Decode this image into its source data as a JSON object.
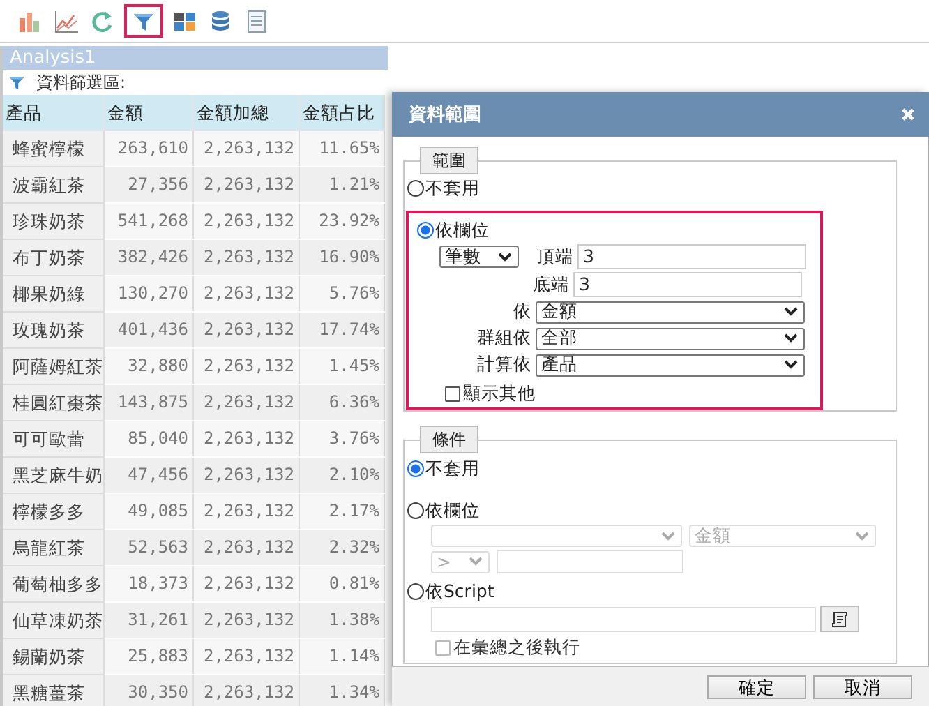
{
  "toolbar": {
    "buttons": [
      {
        "kind": "bar-chart",
        "highlighted": false
      },
      {
        "kind": "line-chart",
        "highlighted": false
      },
      {
        "kind": "refresh",
        "highlighted": false
      },
      {
        "kind": "filter",
        "highlighted": true
      },
      {
        "kind": "crosstab",
        "highlighted": false
      },
      {
        "kind": "database",
        "highlighted": false
      },
      {
        "kind": "report",
        "highlighted": false
      }
    ]
  },
  "panel": {
    "title": "Analysis1",
    "filter_label": "資料篩選區:",
    "table": {
      "columns": [
        "產品",
        "金額",
        "金額加總",
        "金額占比"
      ],
      "rows": [
        [
          "蜂蜜檸檬",
          "263,610",
          "2,263,132",
          "11.65%"
        ],
        [
          "波霸紅茶",
          "27,356",
          "2,263,132",
          "1.21%"
        ],
        [
          "珍珠奶茶",
          "541,268",
          "2,263,132",
          "23.92%"
        ],
        [
          "布丁奶茶",
          "382,426",
          "2,263,132",
          "16.90%"
        ],
        [
          "椰果奶綠",
          "130,270",
          "2,263,132",
          "5.76%"
        ],
        [
          "玫瑰奶茶",
          "401,436",
          "2,263,132",
          "17.74%"
        ],
        [
          "阿薩姆紅茶",
          "32,880",
          "2,263,132",
          "1.45%"
        ],
        [
          "桂圓紅棗茶",
          "143,875",
          "2,263,132",
          "6.36%"
        ],
        [
          "可可歐蕾",
          "85,040",
          "2,263,132",
          "3.76%"
        ],
        [
          "黑芝麻牛奶",
          "47,456",
          "2,263,132",
          "2.10%"
        ],
        [
          "檸檬多多",
          "49,085",
          "2,263,132",
          "2.17%"
        ],
        [
          "烏龍紅茶",
          "52,563",
          "2,263,132",
          "2.32%"
        ],
        [
          "葡萄柚多多",
          "18,373",
          "2,263,132",
          "0.81%"
        ],
        [
          "仙草凍奶茶",
          "31,261",
          "2,263,132",
          "1.38%"
        ],
        [
          "錫蘭奶茶",
          "25,883",
          "2,263,132",
          "1.14%"
        ],
        [
          "黑糖薑茶",
          "30,350",
          "2,263,132",
          "1.34%"
        ]
      ]
    }
  },
  "dialog": {
    "title": "資料範圍",
    "range": {
      "legend": "範圍",
      "options": [
        {
          "kind": "none",
          "label": "不套用",
          "selected": false,
          "highlighted": false
        },
        {
          "kind": "field",
          "label": "依欄位",
          "selected": true,
          "highlighted": true
        }
      ],
      "mode": "筆數",
      "top_label": "頂端",
      "top_value": "3",
      "bottom_label": "底端",
      "bottom_value": "3",
      "by_label": "依",
      "by_value": "金額",
      "group_label": "群組依",
      "group_value": "全部",
      "calc_label": "計算依",
      "calc_value": "產品",
      "show_others": {
        "label": "顯示其他",
        "checked": false
      }
    },
    "condition": {
      "legend": "條件",
      "options": [
        {
          "kind": "none",
          "label": "不套用",
          "selected": true
        },
        {
          "kind": "field",
          "label": "依欄位",
          "selected": false,
          "value_field": "金額",
          "operator": ">"
        },
        {
          "kind": "script",
          "label": "依Script",
          "selected": false,
          "after_summary": {
            "label": "在彙總之後執行",
            "checked": false
          }
        }
      ]
    },
    "buttons": [
      "確定",
      "取消"
    ]
  }
}
